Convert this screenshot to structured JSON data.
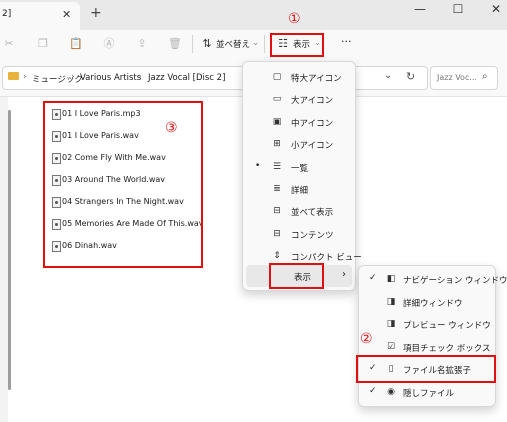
{
  "tab": {
    "title": "2]",
    "close": "✕",
    "new": "+"
  },
  "window_controls": {
    "minimize": "—",
    "maximize": "☐",
    "close": "✕"
  },
  "toolbar": {
    "sort_label": "並べ替え",
    "view_label": "表示",
    "more_label": "···"
  },
  "breadcrumb": {
    "sep": "›",
    "items": [
      "ミュージック",
      "Various Artists",
      "Jazz Vocal [Disc 2]"
    ]
  },
  "search": {
    "placeholder": "Jazz Voc..."
  },
  "files": [
    "01 I Love Paris.mp3",
    "01 I Love Paris.wav",
    "02 Come Fly With Me.wav",
    "03 Around The World.wav",
    "04 Strangers In The Night.wav",
    "05 Memories Are Made Of This.wav",
    "06 Dinah.wav"
  ],
  "annotations": {
    "one": "①",
    "two": "②",
    "three": "③"
  },
  "view_menu": {
    "items": [
      {
        "label": "特大アイコン",
        "icon": "▢"
      },
      {
        "label": "大アイコン",
        "icon": "▭"
      },
      {
        "label": "中アイコン",
        "icon": "▣"
      },
      {
        "label": "小アイコン",
        "icon": "⊞"
      },
      {
        "label": "一覧",
        "icon": "☰",
        "bullet": "•"
      },
      {
        "label": "詳細",
        "icon": "≣"
      },
      {
        "label": "並べて表示",
        "icon": "⊟"
      },
      {
        "label": "コンテンツ",
        "icon": "⊟"
      },
      {
        "label": "コンパクト ビュー",
        "icon": "⇕"
      }
    ],
    "show_label": "表示",
    "show_arrow": "›"
  },
  "show_menu": {
    "items": [
      {
        "label": "ナビゲーション ウィンドウ",
        "check": "✓",
        "icon": "◧"
      },
      {
        "label": "詳細ウィンドウ",
        "check": "",
        "icon": "◨"
      },
      {
        "label": "プレビュー ウィンドウ",
        "check": "",
        "icon": "◨"
      },
      {
        "label": "項目チェック ボックス",
        "check": "",
        "icon": "☑"
      },
      {
        "label": "ファイル名拡張子",
        "check": "✓",
        "icon": "▯"
      },
      {
        "label": "隠しファイル",
        "check": "✓",
        "icon": "◉"
      }
    ]
  },
  "colors": {
    "accent": "#e01010",
    "background": "#ffffff"
  }
}
